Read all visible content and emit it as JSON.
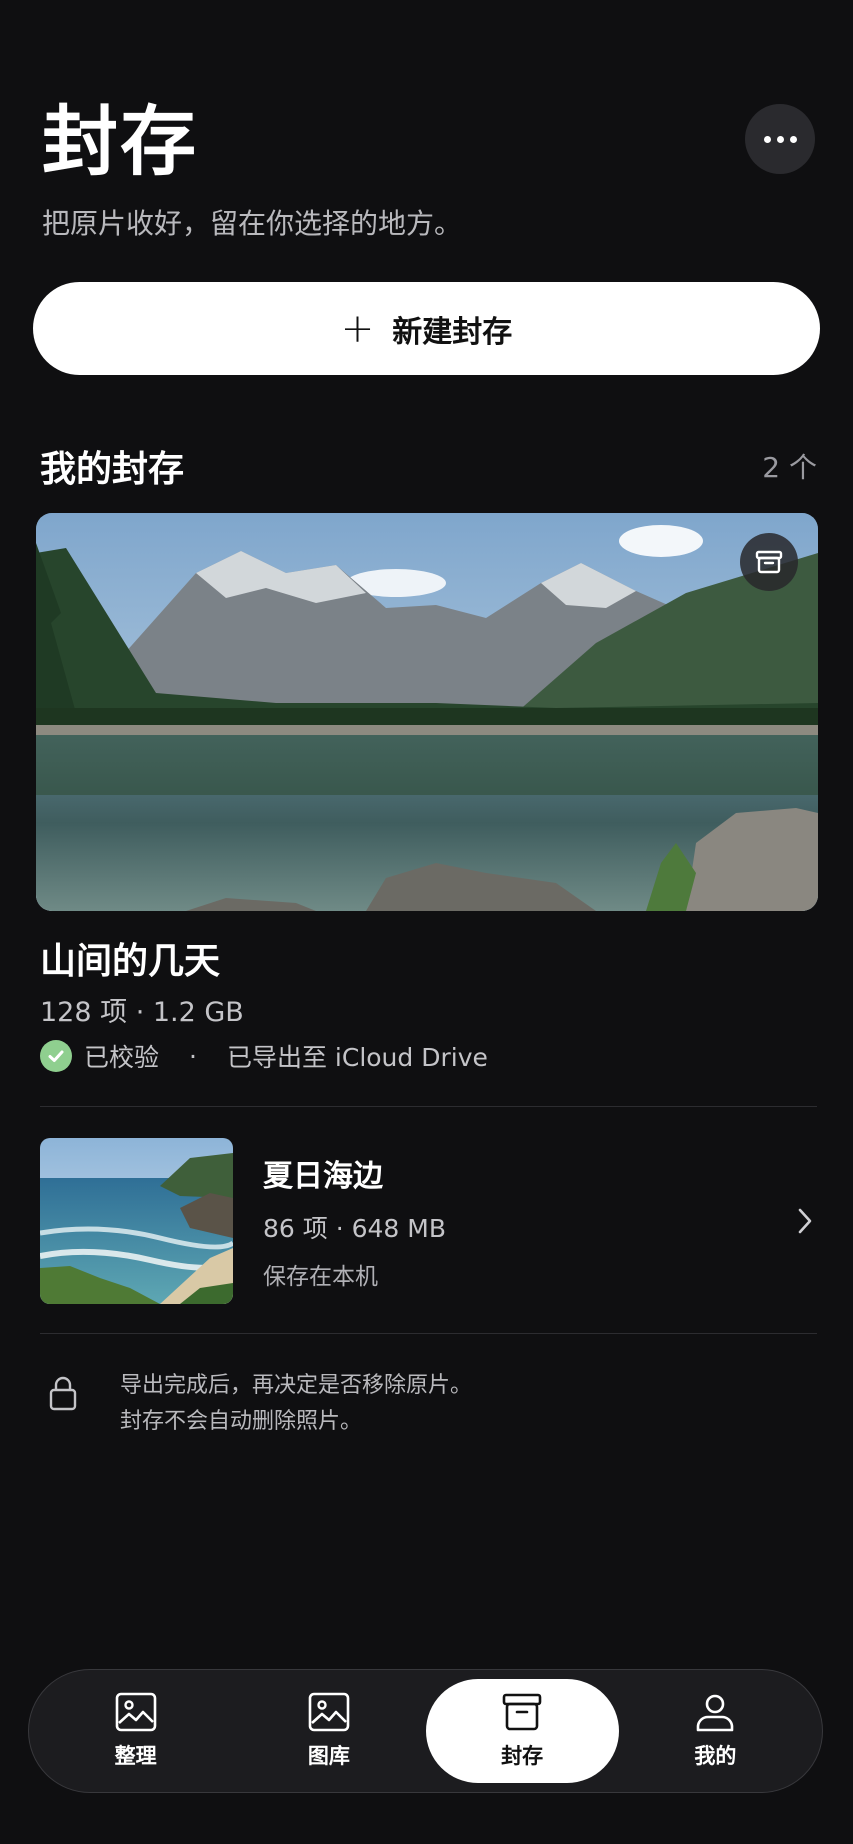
{
  "header": {
    "title": "封存",
    "subtitle": "把原片收好，留在你选择的地方。"
  },
  "actions": {
    "more_icon": "ellipsis-icon",
    "new_label": "新建封存"
  },
  "section": {
    "title": "我的封存",
    "count": "2 个"
  },
  "featured": {
    "name": "山间的几天",
    "meta": "128 项 · 1.2 GB",
    "verified": "已校验",
    "separator": "·",
    "exported": "已导出至 iCloud Drive",
    "badge_icon": "archive-box-icon",
    "verified_color": "#8fcf8f"
  },
  "archives": [
    {
      "name": "夏日海边",
      "meta": "86 项 · 648 MB",
      "location": "保存在本机"
    }
  ],
  "note": {
    "line1": "导出完成后，再决定是否移除原片。",
    "line2": "封存不会自动删除照片。"
  },
  "tabs": [
    {
      "label": "整理",
      "icon": "photo-icon",
      "active": false
    },
    {
      "label": "图库",
      "icon": "photo-icon",
      "active": false
    },
    {
      "label": "封存",
      "icon": "archive-box-icon",
      "active": true
    },
    {
      "label": "我的",
      "icon": "person-icon",
      "active": false
    }
  ]
}
